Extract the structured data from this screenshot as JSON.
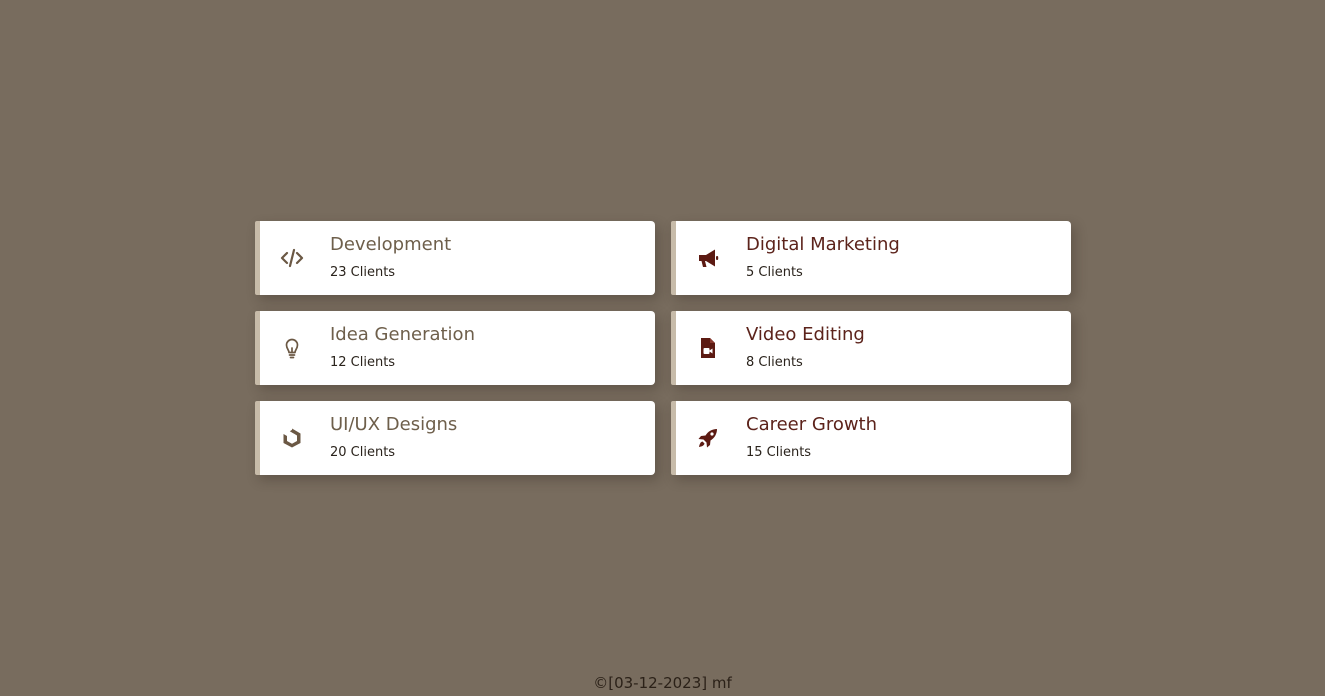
{
  "cards": [
    {
      "title": "Development",
      "count": "23 Clients",
      "icon": "code-icon"
    },
    {
      "title": "Digital Marketing",
      "count": "5 Clients",
      "icon": "megaphone-icon"
    },
    {
      "title": "Idea Generation",
      "count": "12 Clients",
      "icon": "lightbulb-icon"
    },
    {
      "title": "Video Editing",
      "count": "8 Clients",
      "icon": "video-file-icon"
    },
    {
      "title": "UI/UX Designs",
      "count": "20 Clients",
      "icon": "uikit-icon"
    },
    {
      "title": "Career Growth",
      "count": "15 Clients",
      "icon": "rocket-icon"
    }
  ],
  "colors": {
    "background": "#786c5e",
    "card_accent": "#c7bba9",
    "title_brown": "#6e5f4b",
    "title_red": "#5c231b",
    "icon_brown": "#6b5844",
    "icon_red": "#5c1a12"
  },
  "footer": {
    "text": "©[03-12-2023] mf"
  }
}
